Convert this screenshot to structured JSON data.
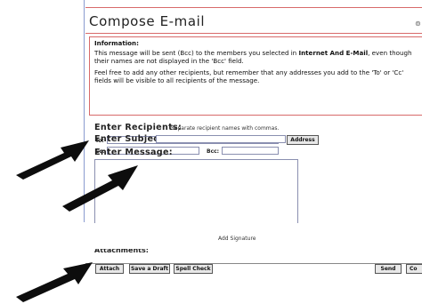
{
  "page": {
    "title": "Compose E-mail",
    "title_control": "⊚"
  },
  "info": {
    "heading": "Information:",
    "p1_before": "This message will be sent (Bcc) to the members you selected in ",
    "p1_bold": "Internet And E-Mail",
    "p1_after": ", even though their names are not displayed in the 'Bcc' field.",
    "p2": "Feel free to add any other recipients, but remember that any addresses you add to the 'To' or 'Cc' fields will be visible to all recipients of the message."
  },
  "recipients": {
    "heading": "Enter Recipients:",
    "note": "Separate recipient names with commas.",
    "to_label": "To:",
    "cc_label": "Cc:",
    "bcc_label": "Bcc:",
    "address_button": "Address"
  },
  "subject": {
    "heading": "Enter Subject:"
  },
  "message": {
    "heading": "Enter Message:",
    "add_signature": "Add Signature"
  },
  "attachments": {
    "heading": "Attachments:"
  },
  "toolbar": {
    "attach": "Attach",
    "save_draft": "Save a Draft",
    "spell_check": "Spell Check",
    "send": "Send",
    "cancel": "Co"
  },
  "arrows": [
    "black-pointer-arrow",
    "black-pointer-arrow",
    "black-pointer-arrow",
    "black-pointer-arrow"
  ]
}
